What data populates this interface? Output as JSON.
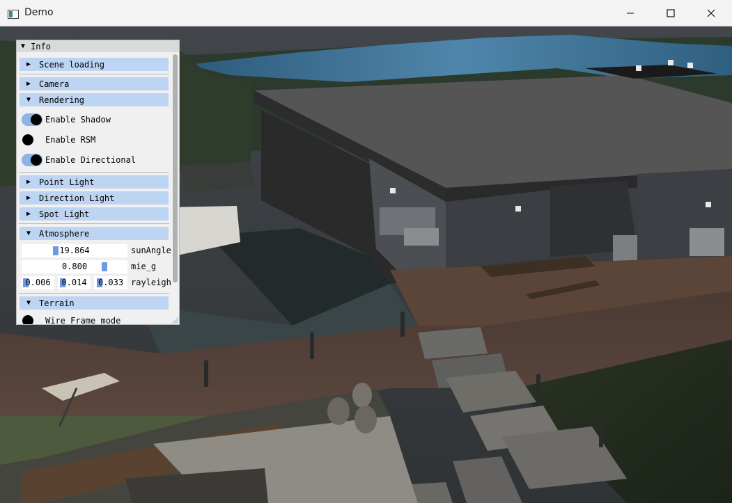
{
  "window": {
    "title": "Demo",
    "minimize_glyph": "─",
    "maximize_glyph": "☐",
    "close_glyph": "✕"
  },
  "panel": {
    "title": "Info",
    "sections": {
      "scene_loading": "Scene loading",
      "camera": "Camera",
      "rendering": "Rendering",
      "point_light": "Point Light",
      "direction_light": "Direction Light",
      "spot_light": "Spot Light",
      "atmosphere": "Atmosphere",
      "terrain": "Terrain"
    },
    "rendering": {
      "enable_shadow": {
        "label": "Enable Shadow",
        "on": true
      },
      "enable_rsm": {
        "label": "Enable RSM",
        "on": false
      },
      "enable_directional": {
        "label": "Enable Directional",
        "on": true
      }
    },
    "atmosphere": {
      "sun_angle": {
        "label": "sunAngle",
        "value": "19.864"
      },
      "mie_g": {
        "label": "mie_g",
        "value": "0.800"
      },
      "rayleigh": {
        "label": "rayleigh",
        "values": [
          "0.006",
          "0.014",
          "0.033"
        ]
      }
    },
    "terrain": {
      "wire_frame": {
        "label": "Wire Frame mode",
        "on": false
      }
    }
  },
  "colors": {
    "header_bg": "#bdd5f2",
    "toggle_on": "#8fb3e5",
    "slider_grab": "#6d9ae3",
    "panel_bg": "#f0f0f0"
  }
}
